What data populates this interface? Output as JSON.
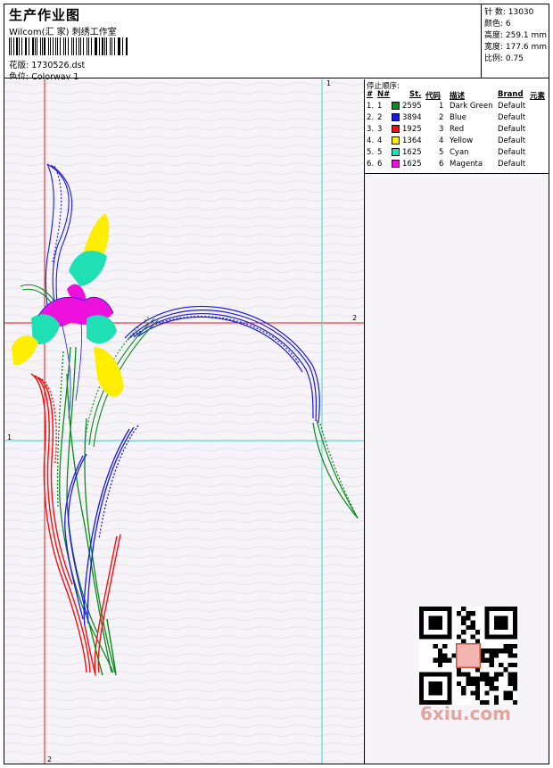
{
  "header": {
    "title": "生产作业图",
    "company": "Wilcom(汇 家) 刺绣工作室",
    "design_label": "花版: 1730526.dst",
    "colorway_label": "色位: Colorway 1"
  },
  "stats": {
    "stitches": "针 数: 13030",
    "colors": "颜色: 6",
    "height": "高度: 259.1 mm",
    "width": "宽度: 177.6 mm",
    "scale": "比例: 0.75"
  },
  "stop_sequence": {
    "title": "停止顺序:",
    "headers": {
      "num": "#",
      "no": "N#",
      "stitches": "St.",
      "code": "代码",
      "desc": "描述",
      "brand": "Brand",
      "element": "元素"
    },
    "rows": [
      {
        "num": "1.",
        "no": "1",
        "color": "#0b8a1c",
        "stitches": "2595",
        "code": "1",
        "desc": "Dark Green",
        "brand": "Default"
      },
      {
        "num": "2.",
        "no": "2",
        "color": "#1b19e0",
        "stitches": "3894",
        "code": "2",
        "desc": "Blue",
        "brand": "Default"
      },
      {
        "num": "3.",
        "no": "3",
        "color": "#ee1111",
        "stitches": "1925",
        "code": "3",
        "desc": "Red",
        "brand": "Default"
      },
      {
        "num": "4.",
        "no": "4",
        "color": "#ffee00",
        "stitches": "1364",
        "code": "4",
        "desc": "Yellow",
        "brand": "Default"
      },
      {
        "num": "5.",
        "no": "5",
        "color": "#1ee0b4",
        "stitches": "1625",
        "code": "5",
        "desc": "Cyan",
        "brand": "Default"
      },
      {
        "num": "6.",
        "no": "6",
        "color": "#ee11dd",
        "stitches": "1625",
        "code": "6",
        "desc": "Magenta",
        "brand": "Default"
      }
    ]
  },
  "guides": {
    "h1": "1",
    "h2": "2",
    "v1": "1",
    "v2": "2"
  },
  "watermark": "6xiu.com",
  "colors": {
    "red_guide": "#e01818",
    "cyan_guide": "#38d8c8",
    "background": "#f6f4f8"
  }
}
